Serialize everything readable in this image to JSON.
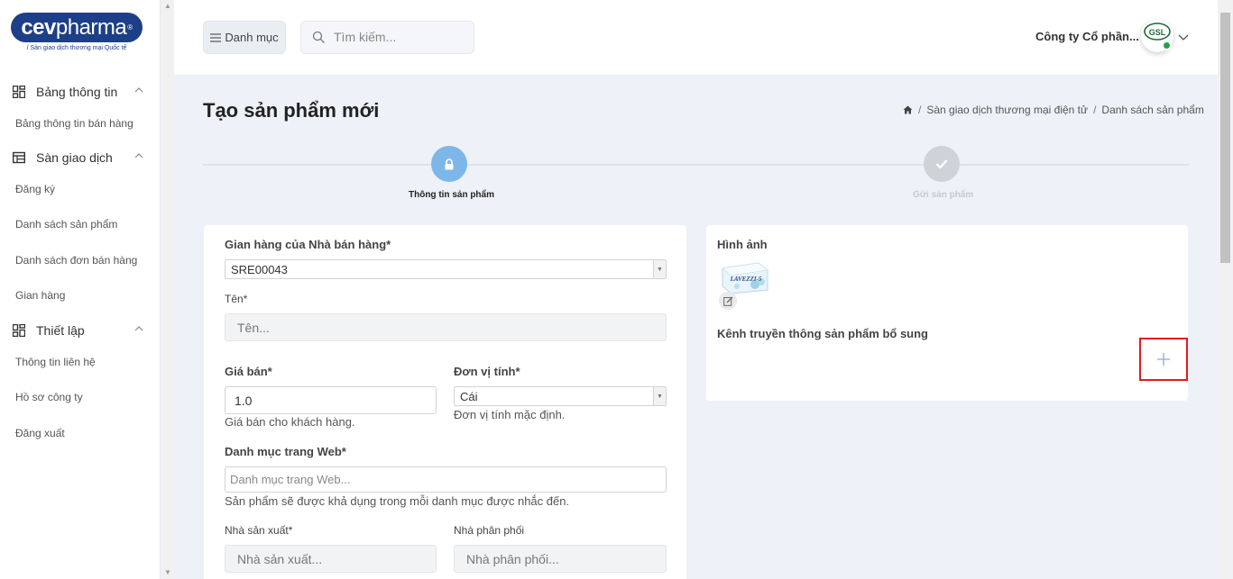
{
  "logo": {
    "brand_bold": "cev",
    "brand_light": "pharma",
    "reg": "®",
    "tagline": "/ Sàn giao dịch thương mại Quốc tế"
  },
  "sidebar": {
    "groups": [
      {
        "label": "Bảng thông tin",
        "items": [
          "Bảng thông tin bán hàng"
        ]
      },
      {
        "label": "Sàn giao dịch",
        "items": [
          "Đăng ký",
          "Danh sách sản phẩm",
          "Danh sách đơn bán hàng",
          "Gian hàng"
        ]
      },
      {
        "label": "Thiết lập",
        "items": [
          "Thông tin liên hệ",
          "Hồ sơ công ty",
          "Đăng xuất"
        ]
      }
    ]
  },
  "header": {
    "menu_label": "Danh mục",
    "search_placeholder": "Tìm kiếm...",
    "company": "Công ty Cổ phần...",
    "avatar_text": "GSL"
  },
  "page": {
    "title": "Tạo sản phẩm mới",
    "breadcrumb": [
      "Sàn giao dịch thương mại điện tử",
      "Danh sách sản phẩm"
    ]
  },
  "stepper": {
    "steps": [
      {
        "label": "Thông tin sản phẩm"
      },
      {
        "label": "Gửi sản phẩm"
      }
    ]
  },
  "form": {
    "store_label": "Gian hàng của Nhà bán hàng*",
    "store_value": "SRE00043",
    "name_label": "Tên*",
    "name_placeholder": "Tên...",
    "price_label": "Giá bán*",
    "price_value": "1.0",
    "price_help": "Giá bán cho khách hàng.",
    "unit_label": "Đơn vị tính*",
    "unit_value": "Cái",
    "unit_help": "Đơn vị tính mặc định.",
    "web_cat_label": "Danh mục trang Web*",
    "web_cat_placeholder": "Danh mục trang Web...",
    "web_cat_help": "Sản phẩm sẽ được khả dụng trong mỗi danh mục được nhắc đến.",
    "manufacturer_label": "Nhà sản xuất*",
    "manufacturer_placeholder": "Nhà sản xuất...",
    "distributor_label": "Nhà phân phối",
    "distributor_placeholder": "Nhà phân phối..."
  },
  "media": {
    "image_label": "Hình ảnh",
    "product_box_text": "LAVEZZI-5",
    "extra_label": "Kênh truyền thông sản phẩm bổ sung"
  },
  "colors": {
    "brand": "#1d3f87",
    "step_active": "#7db7ea",
    "step_inactive": "#cfd2d6",
    "highlight": "#e31b1b",
    "online": "#1fa34a"
  }
}
